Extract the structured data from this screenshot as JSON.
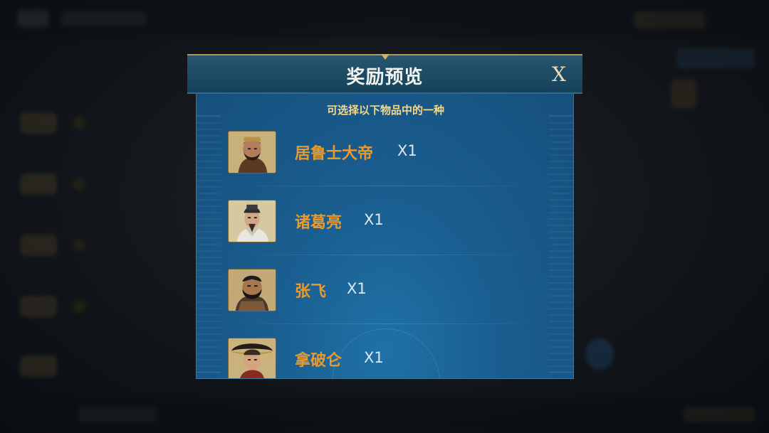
{
  "modal": {
    "title": "奖励预览",
    "close_label": "X",
    "subtitle": "可选择以下物品中的一种"
  },
  "rewards": [
    {
      "name": "居鲁士大帝",
      "quantity": "X1",
      "icon": "cyrus-portrait"
    },
    {
      "name": "诸葛亮",
      "quantity": "X1",
      "icon": "zhuge-liang-portrait"
    },
    {
      "name": "张飞",
      "quantity": "X1",
      "icon": "zhang-fei-portrait"
    },
    {
      "name": "拿破仑",
      "quantity": "X1",
      "icon": "napoleon-portrait"
    }
  ],
  "colors": {
    "header": "#1c4a63",
    "body": "#1a5f91",
    "title": "#f2f2ee",
    "subtitle": "#f4d78a",
    "reward_name": "#e99a2f",
    "quantity": "#dbe8f2",
    "gold_trim": "#b9925a"
  }
}
